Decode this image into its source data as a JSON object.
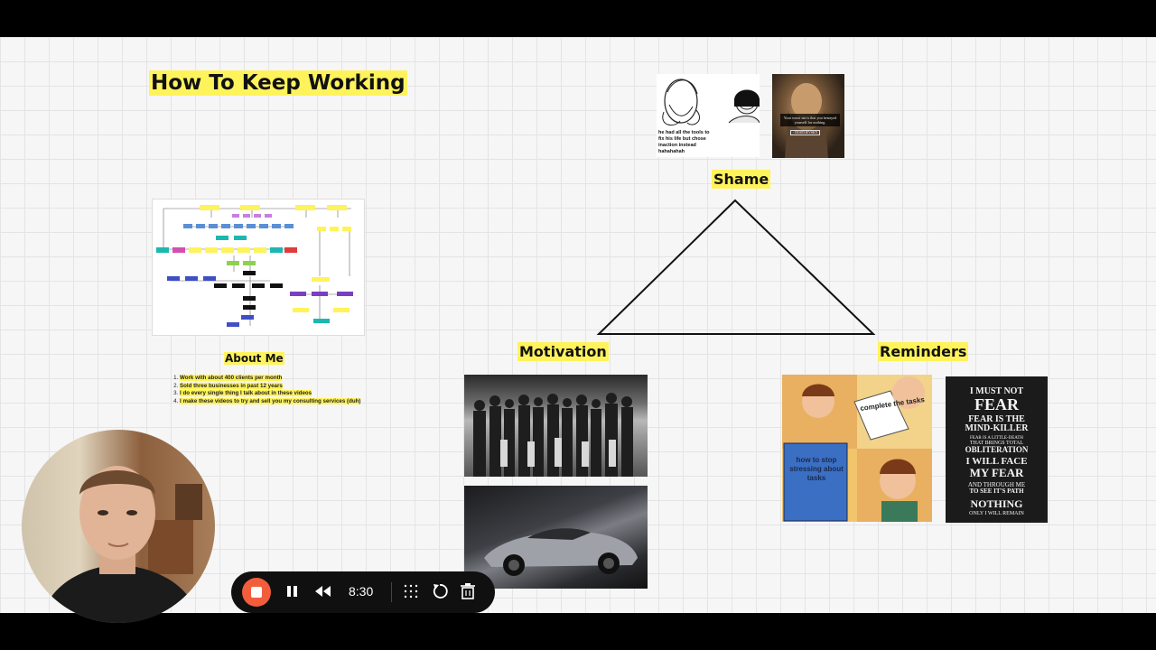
{
  "board": {
    "title": "How To Keep Working",
    "labels": {
      "shame": "Shame",
      "motivation": "Motivation",
      "reminders": "Reminders",
      "about_me": "About Me"
    },
    "about_items": [
      "Work with about 400 clients per month",
      "Sold three businesses in past 12 years",
      "I do every single thing I talk about in these videos",
      "I make these videos to try and sell you my consulting services (duh)"
    ],
    "meme_caption": "he had all the tools to fix his life but chose inaction instead hahahahah",
    "dostoevsky_quote": "Your worst sin is that you betrayed yourself for nothing.",
    "dostoevsky_author": "- DOSTOEVSKY",
    "book_meme": {
      "card_text": "complete the tasks",
      "book_title": "how to stop stressing about tasks"
    },
    "fear_poster": [
      "I MUST NOT",
      "FEAR",
      "FEAR IS THE",
      "MIND-KILLER",
      "FEAR IS A LITTLE-DEATH",
      "THAT BRINGS TOTAL",
      "OBLITERATION",
      "I WILL FACE",
      "MY FEAR",
      "AND THROUGH ME",
      "TO SEE IT'S PATH",
      "NOTHING",
      "ONLY I WILL REMAIN"
    ]
  },
  "recorder": {
    "time": "8:30",
    "accent": "#f25d3c"
  },
  "zoom": {
    "level": "8%"
  },
  "colors": {
    "highlight": "#fff35c",
    "canvas": "#f6f6f6"
  }
}
